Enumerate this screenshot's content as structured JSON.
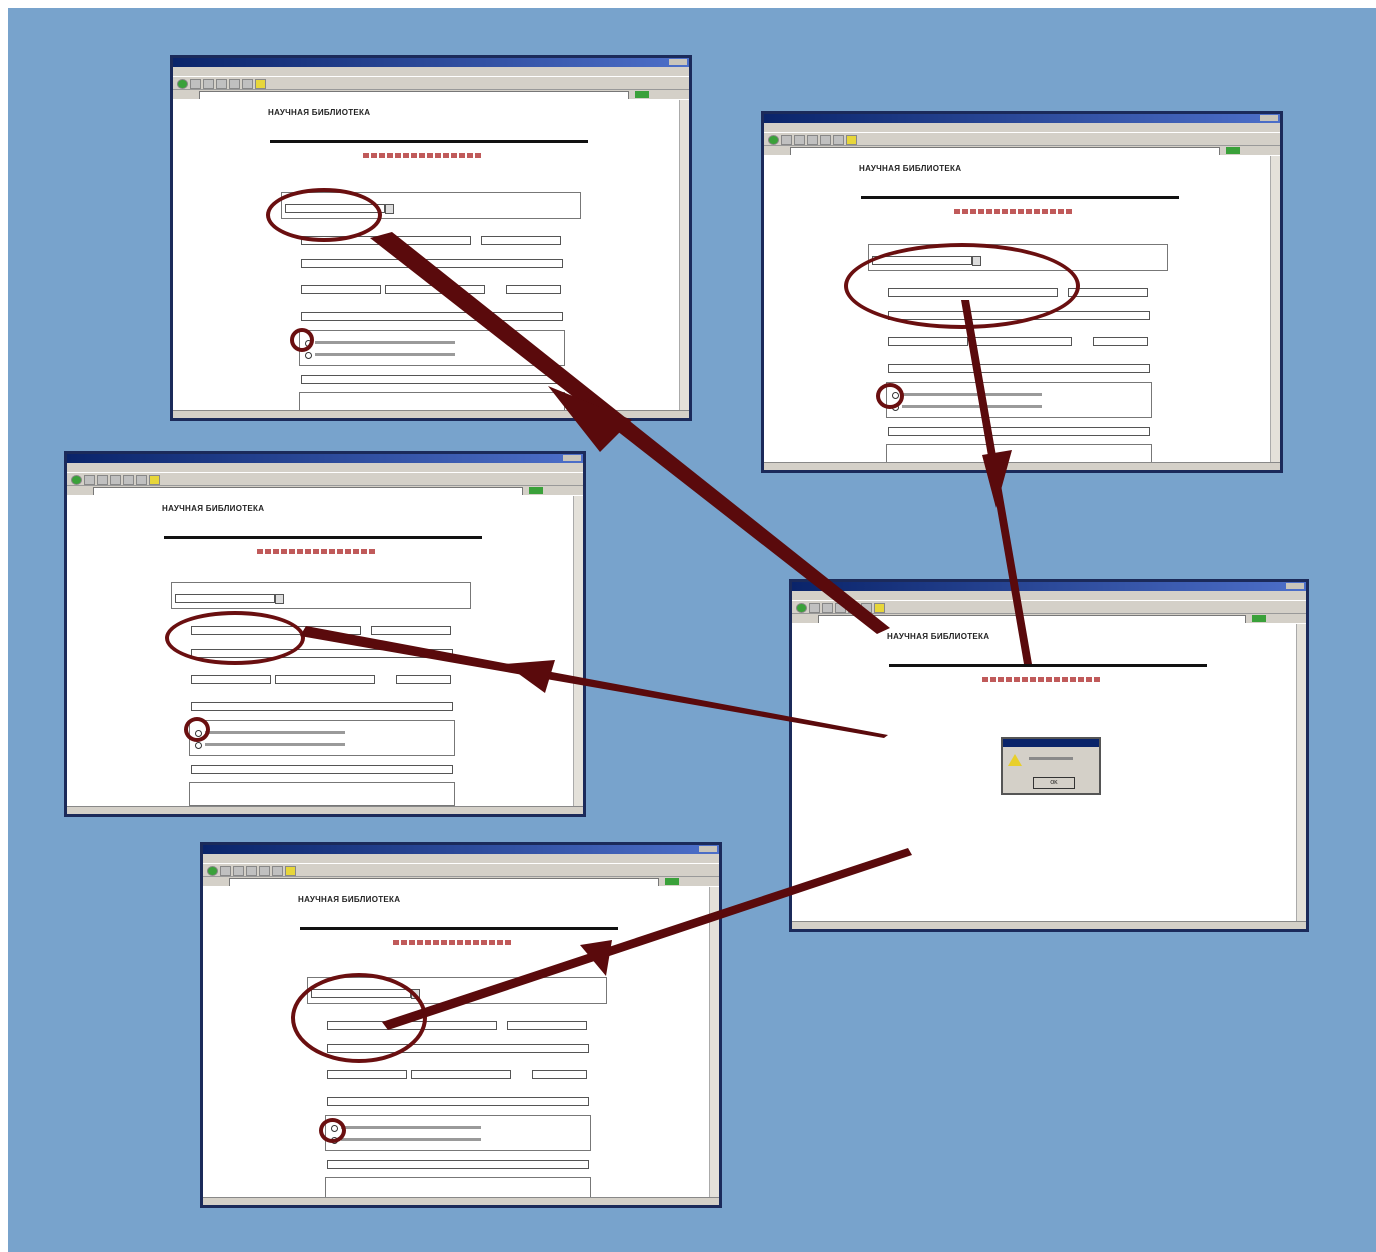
{
  "colors": {
    "background": "#78a3cc",
    "frame": "#ffffff",
    "window_border": "#1b2a5a",
    "title_bar": "#0a246a",
    "chrome": "#d4d0c8",
    "arrow": "#5a0a0c",
    "circle": "#6a0f10",
    "heading": "#a32b2b"
  },
  "windows": [
    {
      "id": "window-top-left",
      "title": "",
      "library_name": "НАУЧНАЯ БИБЛИОТЕКА",
      "dialog": false
    },
    {
      "id": "window-top-right",
      "title": "",
      "library_name": "НАУЧНАЯ БИБЛИОТЕКА",
      "dialog": false
    },
    {
      "id": "window-middle-left",
      "title": "",
      "library_name": "НАУЧНАЯ БИБЛИОТЕКА",
      "dialog": false
    },
    {
      "id": "window-center-right",
      "title": "",
      "library_name": "НАУЧНАЯ БИБЛИОТЕКА",
      "dialog": true
    },
    {
      "id": "window-bottom",
      "title": "",
      "library_name": "НАУЧНАЯ БИБЛИОТЕКА",
      "dialog": false
    }
  ],
  "dialog": {
    "ok_label": "OK"
  },
  "icons": [
    "back-icon",
    "forward-icon",
    "stop-icon",
    "refresh-icon",
    "home-icon",
    "search-icon",
    "favorites-icon",
    "go-icon",
    "warning-icon"
  ]
}
